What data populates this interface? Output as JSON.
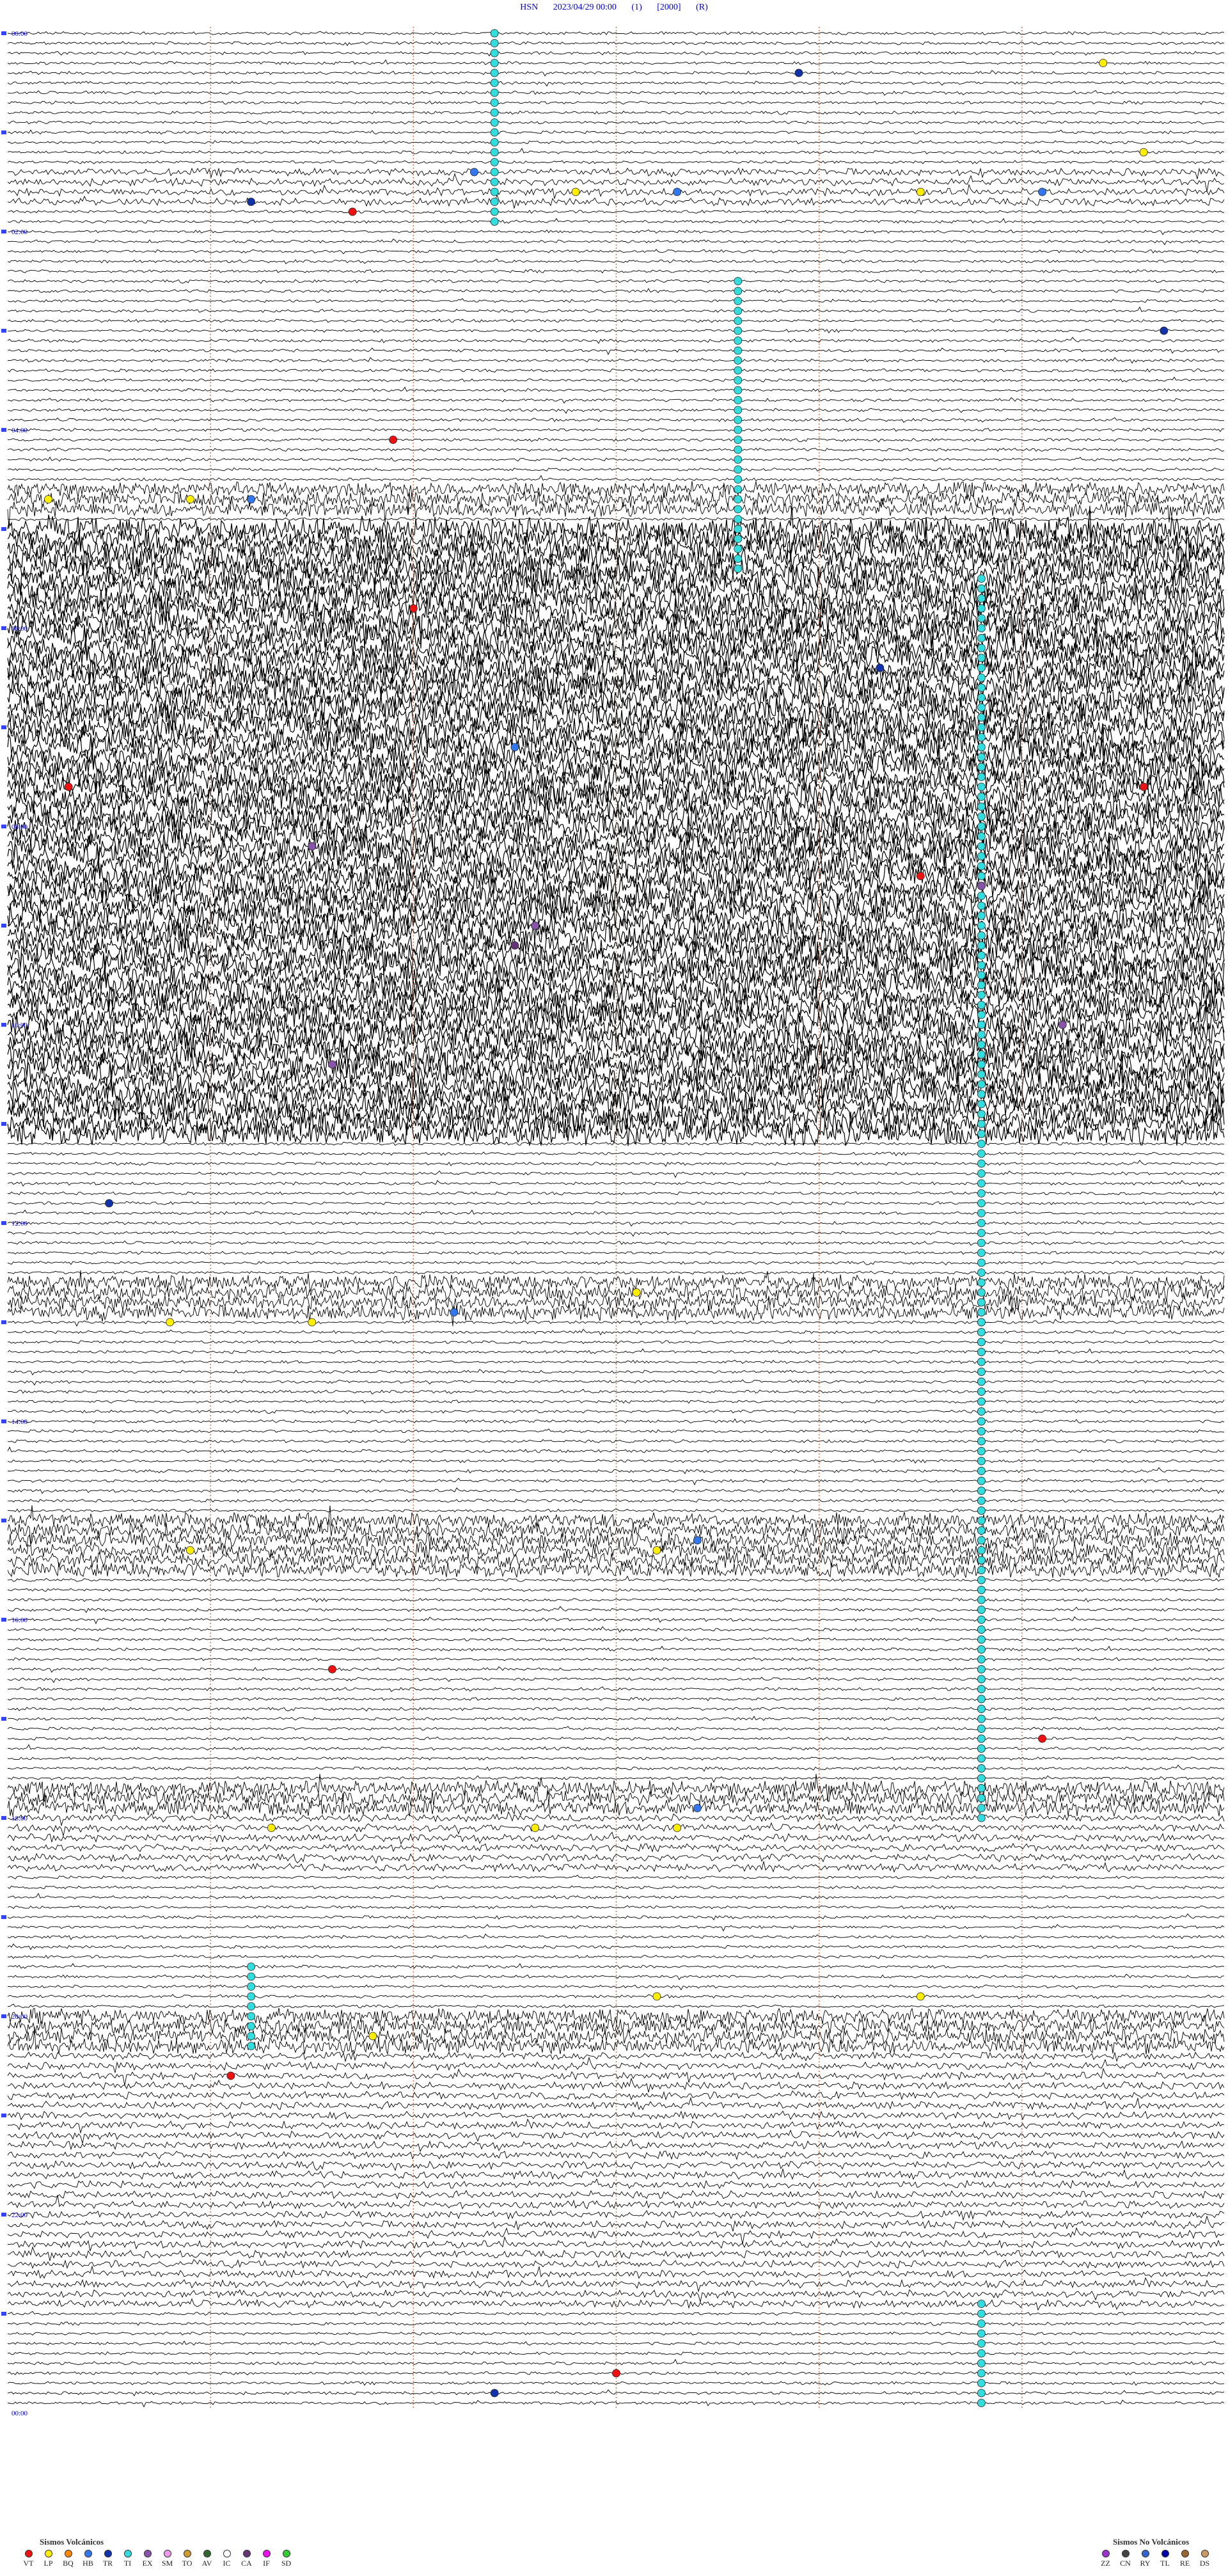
{
  "header": {
    "station": "HSN",
    "datetime": "2023/04/29 00:00",
    "channel": "(1)",
    "gain": "[2000]",
    "mode": "(R)"
  },
  "chart_data": {
    "type": "helicorder",
    "station": "HSN",
    "start": "2023/04/29 00:00",
    "hour_labels": [
      "00:00",
      "02:00",
      "04:00",
      "06:00",
      "08:00",
      "10:00",
      "12:00",
      "14:00",
      "16:00",
      "18:00",
      "20:00",
      "22:00",
      "00:00"
    ],
    "hour_markers": [
      "00:00",
      "01:00",
      "02:00",
      "03:00",
      "04:00",
      "05:00",
      "06:00",
      "07:00",
      "08:00",
      "09:00",
      "10:00",
      "11:00",
      "12:00",
      "13:00",
      "14:00",
      "15:00",
      "16:00",
      "17:00",
      "18:00",
      "19:00",
      "20:00",
      "21:00",
      "22:00",
      "23:00",
      "24:00"
    ],
    "trace_count": 240,
    "minutes_per_trace": 6,
    "activity_periods": [
      {
        "from_hour": 1.35,
        "to_hour": 1.75,
        "level": "moderate"
      },
      {
        "from_hour": 4.55,
        "to_hour": 4.85,
        "level": "high"
      },
      {
        "from_hour": 5.0,
        "to_hour": 11.15,
        "level": "saturated"
      },
      {
        "from_hour": 12.55,
        "to_hour": 12.95,
        "level": "high"
      },
      {
        "from_hour": 15.0,
        "to_hour": 15.6,
        "level": "high"
      },
      {
        "from_hour": 17.7,
        "to_hour": 18.0,
        "level": "high"
      },
      {
        "from_hour": 18.0,
        "to_hour": 18.6,
        "level": "moderate"
      },
      {
        "from_hour": 20.0,
        "to_hour": 20.4,
        "level": "high"
      },
      {
        "from_hour": 20.4,
        "to_hour": 23.0,
        "level": "moderate"
      }
    ],
    "events": [
      {
        "type": "TI",
        "col_min": 2.4,
        "from_trace": 0,
        "to_trace": 19,
        "color": "#33dddd"
      },
      {
        "type": "TI",
        "col_min": 3.6,
        "from_trace": 25,
        "to_trace": 54,
        "color": "#33dddd"
      },
      {
        "type": "TI",
        "col_min": 4.8,
        "from_trace": 55,
        "to_trace": 178,
        "color": "#33dddd"
      },
      {
        "type": "TI",
        "col_min": 4.8,
        "from_trace": 128,
        "to_trace": 180,
        "color": "#33dddd"
      },
      {
        "type": "TI",
        "col_min": 1.2,
        "from_trace": 195,
        "to_trace": 203,
        "color": "#33dddd"
      },
      {
        "type": "TI",
        "col_min": 4.8,
        "from_trace": 229,
        "to_trace": 239,
        "color": "#33dddd"
      },
      {
        "type": "VT",
        "col_min": 1.7,
        "trace": 18,
        "color": "#ee1111"
      },
      {
        "type": "VT",
        "col_min": 1.9,
        "trace": 41,
        "color": "#ee1111"
      },
      {
        "type": "VT",
        "col_min": 2.0,
        "trace": 58,
        "color": "#ee1111"
      },
      {
        "type": "VT",
        "col_min": 0.3,
        "trace": 76,
        "color": "#ee1111"
      },
      {
        "type": "VT",
        "col_min": 4.5,
        "trace": 85,
        "color": "#ee1111"
      },
      {
        "type": "VT",
        "col_min": 5.6,
        "trace": 76,
        "color": "#ee1111"
      },
      {
        "type": "VT",
        "col_min": 1.6,
        "trace": 165,
        "color": "#ee1111"
      },
      {
        "type": "VT",
        "col_min": 5.1,
        "trace": 172,
        "color": "#ee1111"
      },
      {
        "type": "VT",
        "col_min": 1.1,
        "trace": 206,
        "color": "#ee1111"
      },
      {
        "type": "VT",
        "col_min": 3.0,
        "trace": 236,
        "color": "#ee1111"
      },
      {
        "type": "LP",
        "col_min": 2.8,
        "trace": 16,
        "color": "#ffee00"
      },
      {
        "type": "LP",
        "col_min": 4.5,
        "trace": 16,
        "color": "#ffee00"
      },
      {
        "type": "LP",
        "col_min": 0.2,
        "trace": 47,
        "color": "#ffee00"
      },
      {
        "type": "LP",
        "col_min": 0.9,
        "trace": 47,
        "color": "#ffee00"
      },
      {
        "type": "LP",
        "col_min": 0.8,
        "trace": 130,
        "color": "#ffee00"
      },
      {
        "type": "LP",
        "col_min": 1.5,
        "trace": 130,
        "color": "#ffee00"
      },
      {
        "type": "LP",
        "col_min": 3.1,
        "trace": 127,
        "color": "#ffee00"
      },
      {
        "type": "LP",
        "col_min": 3.2,
        "trace": 153,
        "color": "#ffee00"
      },
      {
        "type": "LP",
        "col_min": 0.9,
        "trace": 153,
        "color": "#ffee00"
      },
      {
        "type": "LP",
        "col_min": 1.3,
        "trace": 181,
        "color": "#ffee00"
      },
      {
        "type": "LP",
        "col_min": 2.6,
        "trace": 181,
        "color": "#ffee00"
      },
      {
        "type": "LP",
        "col_min": 3.3,
        "trace": 181,
        "color": "#ffee00"
      },
      {
        "type": "LP",
        "col_min": 4.5,
        "trace": 198,
        "color": "#ffee00"
      },
      {
        "type": "LP",
        "col_min": 3.2,
        "trace": 198,
        "color": "#ffee00"
      },
      {
        "type": "LP",
        "col_min": 1.8,
        "trace": 202,
        "color": "#ffee00"
      },
      {
        "type": "LP",
        "col_min": 5.6,
        "trace": 12,
        "color": "#ffee00"
      },
      {
        "type": "LP",
        "col_min": 5.4,
        "trace": 3,
        "color": "#ffee00"
      },
      {
        "type": "HB",
        "col_min": 2.3,
        "trace": 14,
        "color": "#3377ee"
      },
      {
        "type": "HB",
        "col_min": 5.1,
        "trace": 16,
        "color": "#3377ee"
      },
      {
        "type": "HB",
        "col_min": 3.3,
        "trace": 16,
        "color": "#3377ee"
      },
      {
        "type": "HB",
        "col_min": 1.2,
        "trace": 47,
        "color": "#3377ee"
      },
      {
        "type": "HB",
        "col_min": 2.5,
        "trace": 72,
        "color": "#3377ee"
      },
      {
        "type": "HB",
        "col_min": 2.2,
        "trace": 129,
        "color": "#3377ee"
      },
      {
        "type": "HB",
        "col_min": 3.4,
        "trace": 152,
        "color": "#3377ee"
      },
      {
        "type": "HB",
        "col_min": 3.4,
        "trace": 179,
        "color": "#3377ee"
      },
      {
        "type": "TR",
        "col_min": 3.9,
        "trace": 4,
        "color": "#1133aa"
      },
      {
        "type": "TR",
        "col_min": 1.2,
        "trace": 17,
        "color": "#1133aa"
      },
      {
        "type": "TR",
        "col_min": 5.7,
        "trace": 30,
        "color": "#1133aa"
      },
      {
        "type": "TR",
        "col_min": 4.3,
        "trace": 64,
        "color": "#1133aa"
      },
      {
        "type": "TR",
        "col_min": 0.5,
        "trace": 118,
        "color": "#1133aa"
      },
      {
        "type": "TR",
        "col_min": 2.4,
        "trace": 238,
        "color": "#1133aa"
      },
      {
        "type": "EX",
        "col_min": 1.5,
        "trace": 82,
        "color": "#8855aa"
      },
      {
        "type": "EX",
        "col_min": 4.8,
        "trace": 86,
        "color": "#8855aa"
      },
      {
        "type": "EX",
        "col_min": 2.6,
        "trace": 90,
        "color": "#8855aa"
      },
      {
        "type": "EX",
        "col_min": 5.2,
        "trace": 100,
        "color": "#8855aa"
      },
      {
        "type": "EX",
        "col_min": 1.6,
        "trace": 104,
        "color": "#8855aa"
      },
      {
        "type": "IC",
        "col_min": 0.8,
        "trace": 66,
        "color": "#ffffff"
      },
      {
        "type": "CA",
        "col_min": 2.5,
        "trace": 92,
        "color": "#663377"
      }
    ],
    "legend_volcanic_title": "Sismos Volcánicos",
    "legend_volcanic": [
      {
        "code": "VT",
        "color": "#ee1111"
      },
      {
        "code": "LP",
        "color": "#ffee00"
      },
      {
        "code": "BQ",
        "color": "#ff8800"
      },
      {
        "code": "HB",
        "color": "#3377ee"
      },
      {
        "code": "TR",
        "color": "#1133aa"
      },
      {
        "code": "TI",
        "color": "#33dddd"
      },
      {
        "code": "EX",
        "color": "#8855aa"
      },
      {
        "code": "SM",
        "color": "#ee99ee"
      },
      {
        "code": "TO",
        "color": "#cc9933"
      },
      {
        "code": "AV",
        "color": "#336633"
      },
      {
        "code": "IC",
        "color": "#ffffff"
      },
      {
        "code": "CA",
        "color": "#663377"
      },
      {
        "code": "IF",
        "color": "#ee11ee"
      },
      {
        "code": "SD",
        "color": "#33cc33"
      }
    ],
    "legend_nonvolcanic_title": "Sismos No Volcánicos",
    "legend_nonvolcanic": [
      {
        "code": "ZZ",
        "color": "#9933cc"
      },
      {
        "code": "CN",
        "color": "#444444"
      },
      {
        "code": "RY",
        "color": "#3366cc"
      },
      {
        "code": "TL",
        "color": "#0000aa"
      },
      {
        "code": "RE",
        "color": "#996633"
      },
      {
        "code": "DS",
        "color": "#cc9966"
      }
    ]
  }
}
